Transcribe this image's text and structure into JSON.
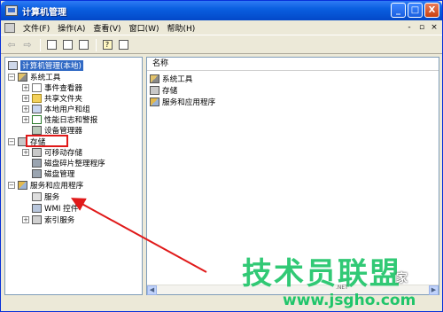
{
  "window": {
    "title": "计算机管理"
  },
  "menubar": {
    "items": [
      "文件(F)",
      "操作(A)",
      "查看(V)",
      "窗口(W)",
      "帮助(H)"
    ]
  },
  "titlebar_buttons": {
    "minimize": "_",
    "maximize": "□",
    "close": "X"
  },
  "mdi_buttons": {
    "minimize": "-",
    "restore": "▫",
    "close": "×"
  },
  "tree": {
    "root": "计算机管理(本地)",
    "nodes": [
      {
        "label": "系统工具",
        "level": 1,
        "expander": "−"
      },
      {
        "label": "事件查看器",
        "level": 2,
        "expander": "+"
      },
      {
        "label": "共享文件夹",
        "level": 2,
        "expander": "+"
      },
      {
        "label": "本地用户和组",
        "level": 2,
        "expander": "+"
      },
      {
        "label": "性能日志和警报",
        "level": 2,
        "expander": "+"
      },
      {
        "label": "设备管理器",
        "level": 2,
        "expander": ""
      },
      {
        "label": "存储",
        "level": 1,
        "expander": "−"
      },
      {
        "label": "可移动存储",
        "level": 2,
        "expander": "+"
      },
      {
        "label": "磁盘碎片整理程序",
        "level": 2,
        "expander": ""
      },
      {
        "label": "磁盘管理",
        "level": 2,
        "expander": ""
      },
      {
        "label": "服务和应用程序",
        "level": 1,
        "expander": "−"
      },
      {
        "label": "服务",
        "level": 2,
        "expander": ""
      },
      {
        "label": "WMI 控件",
        "level": 2,
        "expander": ""
      },
      {
        "label": "索引服务",
        "level": 2,
        "expander": "+"
      }
    ]
  },
  "list": {
    "column_header": "名称",
    "items": [
      "系统工具",
      "存储",
      "服务和应用程序"
    ]
  },
  "watermark": {
    "main": "技术员联盟",
    "sub": "家",
    "url": "www.jsgho.com",
    "url_small": ".NET"
  },
  "colors": {
    "title_blue": "#0A5FE0",
    "selection": "#316AC5",
    "annotation_red": "#e01919",
    "watermark_green": "#20c56a"
  }
}
